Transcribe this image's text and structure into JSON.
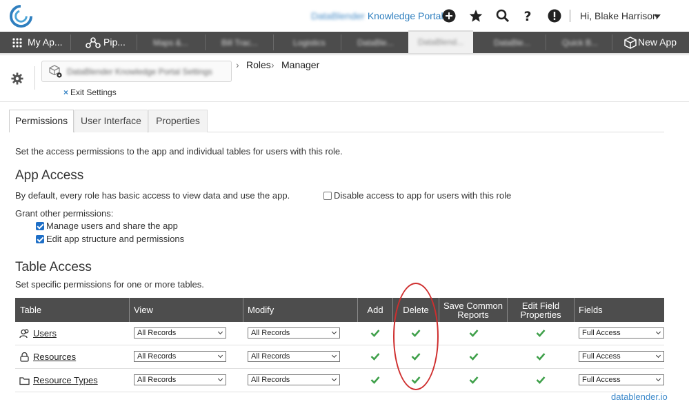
{
  "header": {
    "portal_prefix": "DataBlender",
    "portal_name": "Knowledge Portal",
    "greeting": "Hi, Blake Harrison"
  },
  "appbar": {
    "my_apps": "My Ap...",
    "pipelines": "Pip...",
    "blurred_tabs": [
      "Maps &...",
      "Bill Trac...",
      "Logistics",
      "DataBle...",
      "DataBlend...",
      "DataBle...",
      "Quick B..."
    ],
    "new_app": "New App"
  },
  "settings": {
    "app_settings": "DataBlender Knowledge Portal Settings",
    "crumb_roles": "Roles",
    "crumb_manager": "Manager",
    "exit": "Exit Settings"
  },
  "tabs": [
    "Permissions",
    "User Interface",
    "Properties"
  ],
  "content": {
    "intro": "Set the access permissions to the app and individual tables for users with this role.",
    "app_access_title": "App Access",
    "app_access_desc": "By default, every role has basic access to view data and use the app.",
    "disable_access": "Disable access to app for users with this role",
    "grant_label": "Grant other permissions:",
    "perm_manage": "Manage users and share the app",
    "perm_edit": "Edit app structure and permissions",
    "table_access_title": "Table Access",
    "table_access_desc": "Set specific permissions for one or more tables."
  },
  "table": {
    "headers": {
      "table": "Table",
      "view": "View",
      "modify": "Modify",
      "add": "Add",
      "delete": "Delete",
      "save_line1": "Save Common",
      "save_line2": "Reports",
      "edit_line1": "Edit Field",
      "edit_line2": "Properties",
      "fields": "Fields"
    },
    "rows": [
      {
        "name": "Users",
        "view": "All Records",
        "modify": "All Records",
        "fields": "Full Access",
        "icon": "users-icon"
      },
      {
        "name": "Resources",
        "view": "All Records",
        "modify": "All Records",
        "fields": "Full Access",
        "icon": "lock-icon"
      },
      {
        "name": "Resource Types",
        "view": "All Records",
        "modify": "All Records",
        "fields": "Full Access",
        "icon": "folder-icon"
      }
    ]
  },
  "footer": {
    "brand": "datablender.io"
  },
  "colors": {
    "accent": "#1e6fc7",
    "check": "#3fa04a",
    "highlight": "#cf2e2e",
    "bar": "#4c4c4c"
  }
}
